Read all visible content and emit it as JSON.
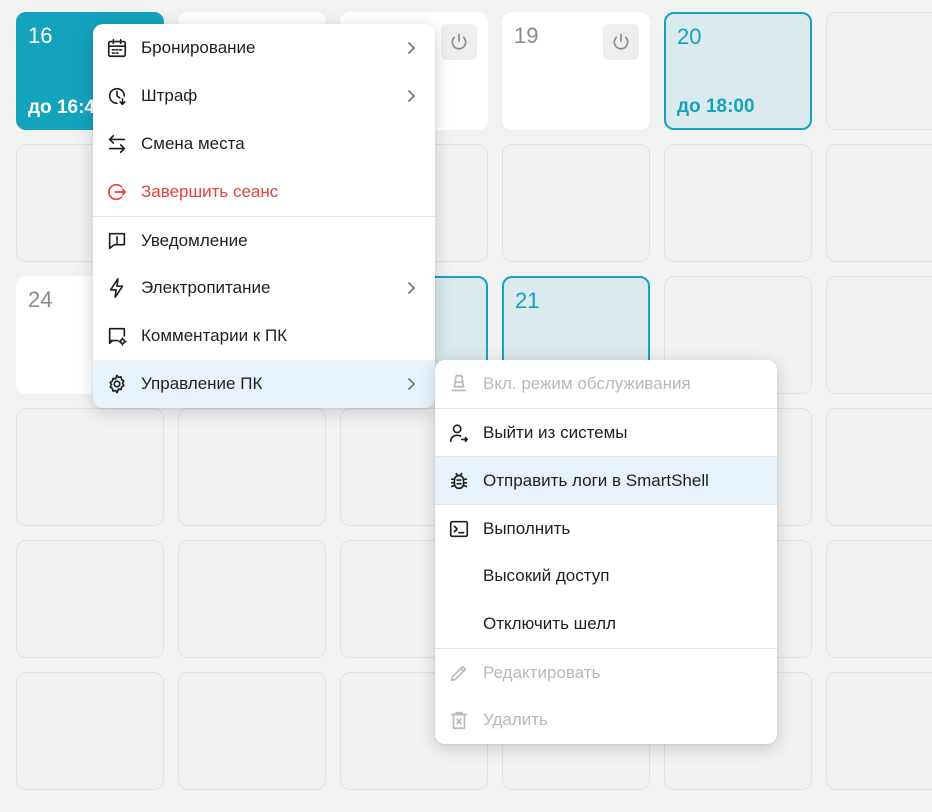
{
  "tiles": {
    "t16": {
      "number": "16",
      "until": "до 16:4"
    },
    "t19": {
      "number": "19"
    },
    "t20": {
      "number": "20",
      "until": "до 18:00"
    },
    "t24": {
      "number": "24"
    },
    "t21": {
      "number": "21"
    }
  },
  "main_menu": {
    "items": [
      {
        "label": "Бронирование",
        "icon": "calendar-icon",
        "submenu": true
      },
      {
        "label": "Штраф",
        "icon": "clock-penalty-icon",
        "submenu": true
      },
      {
        "label": "Смена места",
        "icon": "swap-arrows-icon",
        "submenu": false
      },
      {
        "label": "Завершить сеанс",
        "icon": "logout-circle-icon",
        "submenu": false,
        "danger": true
      },
      {
        "label": "Уведомление",
        "icon": "alert-message-icon",
        "submenu": false
      },
      {
        "label": "Электропитание",
        "icon": "lightning-icon",
        "submenu": true
      },
      {
        "label": "Комментарии к ПК",
        "icon": "monitor-gear-icon",
        "submenu": false
      },
      {
        "label": "Управление ПК",
        "icon": "gear-icon",
        "submenu": true,
        "active": true
      }
    ]
  },
  "sub_menu": {
    "items": [
      {
        "label": "Вкл. режим обслуживания",
        "icon": "maintenance-icon",
        "disabled": true
      },
      {
        "label": "Выйти из системы",
        "icon": "user-exit-icon"
      },
      {
        "label": "Отправить логи в SmartShell",
        "icon": "bug-icon",
        "active": true
      },
      {
        "label": "Выполнить",
        "icon": "terminal-icon"
      },
      {
        "label": "Высокий доступ",
        "icon": ""
      },
      {
        "label": "Отключить шелл",
        "icon": ""
      },
      {
        "label": "Редактировать",
        "icon": "pencil-icon",
        "disabled": true
      },
      {
        "label": "Удалить",
        "icon": "trash-icon",
        "disabled": true
      }
    ]
  },
  "colors": {
    "accent": "#14a3bd",
    "danger": "#e8413c",
    "highlight": "#e8f2fc",
    "disabled": "#b9b9b9"
  }
}
